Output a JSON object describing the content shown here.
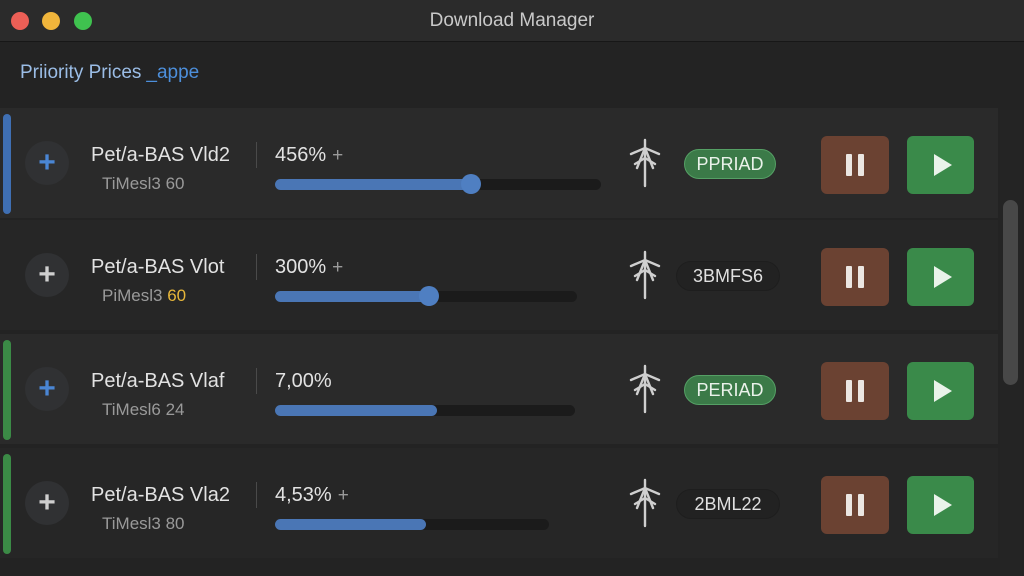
{
  "window": {
    "title": "Download Manager",
    "traffic_lights": [
      {
        "name": "close",
        "color": "#ec5f56"
      },
      {
        "name": "minimize",
        "color": "#f0b53b"
      },
      {
        "name": "zoom",
        "color": "#3fc24f"
      }
    ]
  },
  "header": {
    "label": "Priiority Prices",
    "accent": "_appe"
  },
  "icons": {
    "add": "plus-icon",
    "antenna": "antenna-icon",
    "pause": "pause-icon",
    "play": "play-icon"
  },
  "colors": {
    "accent_blue": "#4a76b5",
    "stripe_blue": "#3f6fb3",
    "stripe_green": "#3b8a46",
    "badge_green": "#3b7a48",
    "pause_bg": "#6b4232",
    "play_bg": "#3a8a4a",
    "highlight_yellow": "#e6b63a"
  },
  "downloads": [
    {
      "name": "Pet/a-BAS Vld2",
      "sub_text": "TiMesl3 60",
      "sub_highlight": "",
      "percent_text": "456%",
      "plus": "+",
      "progress": 0.6,
      "badge": "PPRIAD",
      "badge_style": "green",
      "stripe": "blue"
    },
    {
      "name": "Pet/a-BAS Vlot",
      "sub_text": "PiMesl3 ",
      "sub_highlight": "60",
      "percent_text": "300%",
      "plus": "+",
      "progress": 0.51,
      "badge": "3BMFS6",
      "badge_style": "dark",
      "stripe": "none"
    },
    {
      "name": "Pet/a-BAS Vlaf",
      "sub_text": "TiMesl6 24",
      "sub_highlight": "",
      "percent_text": "7,00%",
      "plus": "",
      "progress": 0.54,
      "badge": "PERIAD",
      "badge_style": "green",
      "stripe": "green"
    },
    {
      "name": "Pet/a-BAS Vla2",
      "sub_text": "TiMesl3 80",
      "sub_highlight": "",
      "percent_text": "4,53%",
      "plus": "+",
      "progress": 0.55,
      "badge": "2BML22",
      "badge_style": "dark",
      "stripe": "green"
    }
  ]
}
